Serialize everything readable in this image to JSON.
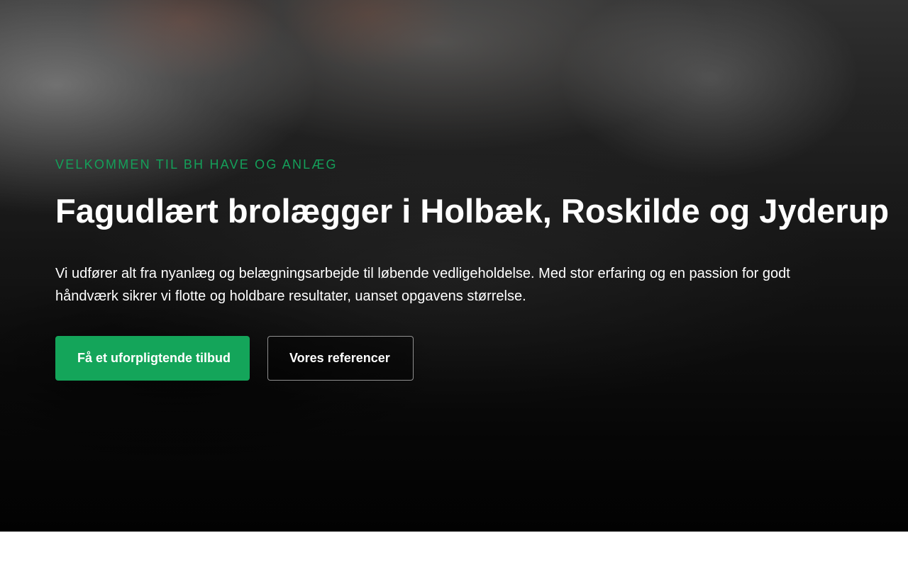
{
  "hero": {
    "eyebrow": "VELKOMMEN TIL BH HAVE OG ANLÆG",
    "headline": "Fagudlært brolægger i Holbæk, Roskilde og Jyderup",
    "lead": "Vi udfører alt fra nyanlæg og belægningsarbejde til løbende vedligeholdelse. Med stor erfaring og en passion for godt håndværk sikrer vi flotte og holdbare resultater, uanset opgavens størrelse.",
    "primary_cta": "Få et uforpligtende tilbud",
    "secondary_cta": "Vores referencer"
  },
  "colors": {
    "accent": "#14a55a",
    "eyebrow": "#14a05a",
    "text_on_dark": "#ffffff"
  }
}
